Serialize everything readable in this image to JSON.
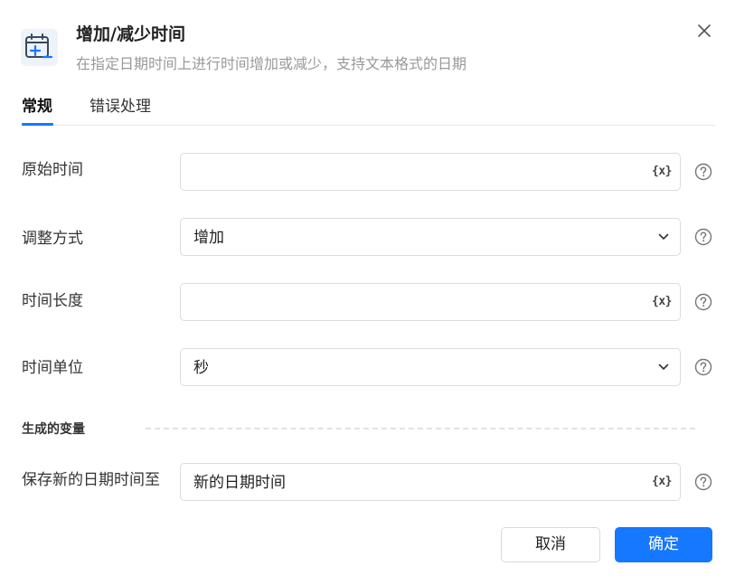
{
  "header": {
    "icon": "calendar-plus-minus-icon",
    "title": "增加/减少时间",
    "subtitle": "在指定日期时间上进行时间增加或减少，支持文本格式的日期",
    "close_icon": "close-icon"
  },
  "tabs": [
    {
      "label": "常规",
      "active": true
    },
    {
      "label": "错误处理",
      "active": false
    }
  ],
  "form": {
    "original_time": {
      "label": "原始时间",
      "value": "",
      "var_label": "{x}"
    },
    "adjust_mode": {
      "label": "调整方式",
      "value": "增加"
    },
    "time_length": {
      "label": "时间长度",
      "value": "",
      "var_label": "{x}"
    },
    "time_unit": {
      "label": "时间单位",
      "value": "秒"
    }
  },
  "output": {
    "section_title": "生成的变量",
    "save_to": {
      "label": "保存新的日期时间至",
      "value": "新的日期时间",
      "var_label": "{x}"
    }
  },
  "buttons": {
    "cancel": "取消",
    "ok": "确定"
  },
  "colors": {
    "accent": "#1677ff",
    "icon_bg": "#eef3fb",
    "border": "#dcdcdc",
    "muted_text": "#999999"
  }
}
